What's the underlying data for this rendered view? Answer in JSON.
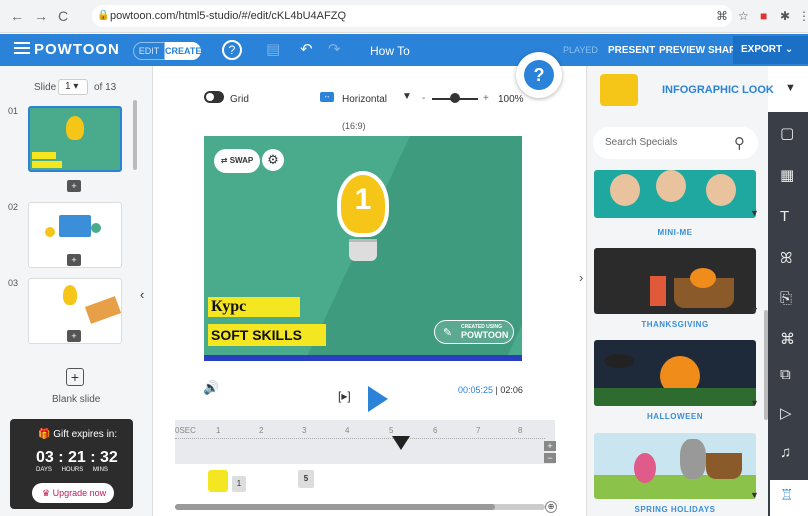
{
  "browser": {
    "url": "powtoon.com/html5-studio/#/edit/cKL4bU4AFZQ"
  },
  "app": {
    "logo": "POWTOON",
    "edit_label": "EDIT",
    "create_label": "CREATE",
    "howto_label": "How To",
    "played_label": "PLAYED",
    "present_label": "PRESENT",
    "preview_label": "PREVIEW",
    "share_label": "SHARE",
    "export_label": "EXPORT",
    "help_label": "?"
  },
  "left": {
    "slide_label": "Slide",
    "slide_value": "1",
    "slide_total": "of 13",
    "slides": [
      {
        "num": "01"
      },
      {
        "num": "02"
      },
      {
        "num": "03"
      }
    ],
    "blank_label": "Blank slide",
    "gift_title": "Gift expires in:",
    "days": "03",
    "hours": "21",
    "mins": "32",
    "days_label": "DAYS",
    "hours_label": "HOURS",
    "mins_label": "MINS",
    "upgrade_label": "Upgrade now"
  },
  "canvas": {
    "grid_label": "Grid",
    "orientation_label": "Horizontal",
    "zoom_label": "100%",
    "ratio_label": "(16:9)",
    "swap_label": "SWAP",
    "line1": "Курс",
    "line2": "SOFT SKILLS",
    "badge_small": "CREATED USING",
    "badge_brand": "POWTOON",
    "bulb_number": "1",
    "time_current": "00:05:25",
    "time_total": "02:06",
    "ticks": [
      "0SEC",
      "1",
      "2",
      "3",
      "4",
      "5",
      "6",
      "7",
      "8"
    ],
    "track_a": "1",
    "track_b": "5"
  },
  "right": {
    "header_label": "INFOGRAPHIC LOOK",
    "search_placeholder": "Search Specials",
    "specials": [
      "MINI-ME",
      "THANKSGIVING",
      "HALLOWEEN",
      "SPRING HOLIDAYS"
    ]
  }
}
